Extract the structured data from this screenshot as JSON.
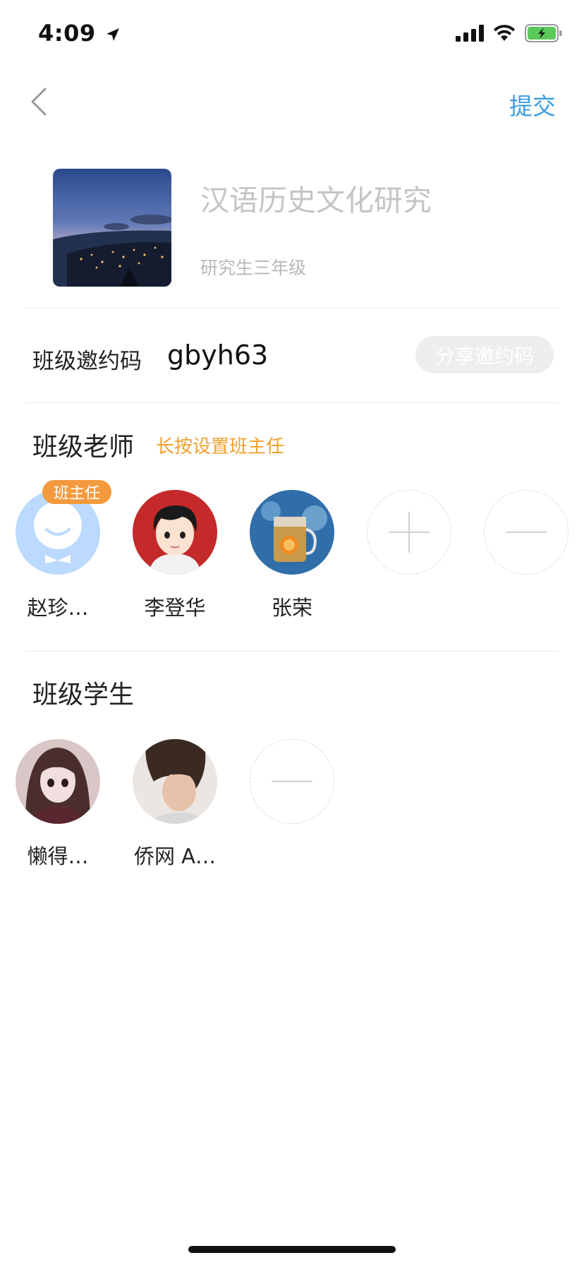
{
  "status_bar": {
    "time": "4:09"
  },
  "nav": {
    "submit_label": "提交"
  },
  "class_info": {
    "name": "汉语历史文化研究",
    "grade": "研究生三年级"
  },
  "invite": {
    "label": "班级邀约码",
    "code": "gbyh63",
    "share_label": "分享邀约码"
  },
  "teachers": {
    "title": "班级老师",
    "hint": "长按设置班主任",
    "head_badge": "班主任",
    "members": [
      {
        "name": "赵珍…"
      },
      {
        "name": "李登华"
      },
      {
        "name": "张荣"
      }
    ]
  },
  "students": {
    "title": "班级学生",
    "members": [
      {
        "name": "懒得…"
      },
      {
        "name": "侨网 A…"
      }
    ]
  },
  "colors": {
    "accent_blue": "#3a9de0",
    "badge_orange": "#f39a3e",
    "hint_orange": "#f0a030"
  }
}
